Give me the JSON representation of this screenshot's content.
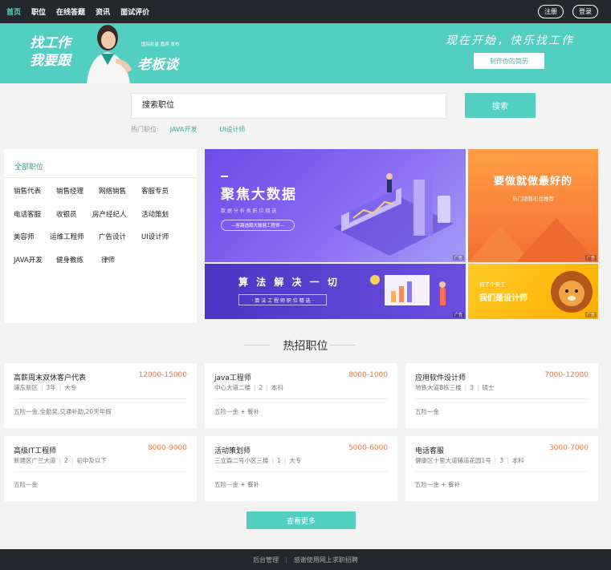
{
  "nav": {
    "items": [
      "首页",
      "职位",
      "在线答题",
      "资讯",
      "面试评价"
    ],
    "register": "注册",
    "login": "登录"
  },
  "banner": {
    "left_line1": "找工作",
    "left_line2": "我要跟",
    "small_text": "国际影星 嘉宾 发布",
    "boss": "老板谈",
    "slogan": "现在开始，快乐找工作",
    "cta": "制作你的简历"
  },
  "search": {
    "placeholder": "搜索职位",
    "button": "搜索",
    "hot_label": "热门职位:",
    "hot_links": [
      "JAVA开发",
      "UI设计师"
    ]
  },
  "categories": {
    "title": "全部职位",
    "items": [
      "销售代表",
      "销售经理",
      "网络销售",
      "客服专员",
      "电话客服",
      "收银员",
      "房产经纪人",
      "活动策划",
      "美容师",
      "运维工程师",
      "广告设计",
      "UI设计师",
      "JAVA开发",
      "健身教练",
      "律师"
    ]
  },
  "promos": {
    "bigdata_title": "聚焦大数据",
    "bigdata_sub": "数 据 分 析 类 职 位 精 选",
    "bigdata_btn": "—各路选聘大数据工程师—",
    "algo_title": "算 法 解 决 一 切",
    "algo_sub": "· 算 法 工 程 师 职 位 精 选 ·",
    "best_title": "要做就做最好的",
    "best_sub": "热门销售职位推荐",
    "designer_small": "招了个美工",
    "designer_title": "我们是设计师",
    "ad_tag": "广告"
  },
  "section_title": "热招职位",
  "jobs": [
    {
      "title": "高薪周末双休客户代表",
      "salary": "12000-15000",
      "meta": [
        "浦东新区",
        "3年",
        "大专"
      ],
      "benefit": "五险一金,全勤奖,交通补助,20天年假"
    },
    {
      "title": "java工程师",
      "salary": "8000-1000",
      "meta": [
        "中心大道二楼",
        "2",
        "本科"
      ],
      "benefit": "五险一金 + 餐补"
    },
    {
      "title": "应用软件设计师",
      "salary": "7000-12000",
      "meta": [
        "地铁大道B栋三楼",
        "3",
        "硕士"
      ],
      "benefit": "五险一金"
    },
    {
      "title": "高级IT工程师",
      "salary": "8000-9000",
      "meta": [
        "新建区广兰大道",
        "2",
        "初中及以下"
      ],
      "benefit": "五险一金"
    },
    {
      "title": "活动策划师",
      "salary": "5000-6000",
      "meta": [
        "三立森二号小区三楼",
        "1",
        "大专"
      ],
      "benefit": "五险一金 + 餐补"
    },
    {
      "title": "电话客服",
      "salary": "3000-7000",
      "meta": [
        "健康区十里大道辅道花园1号",
        "3",
        "本科"
      ],
      "benefit": "五险一金 + 餐补"
    }
  ],
  "more_button": "查看更多",
  "footer": {
    "admin": "后台管理",
    "thanks": "感谢使用网上求职招聘"
  },
  "colors": {
    "accent": "#52cfc1",
    "dark": "#24272c",
    "salary": "#ea7a3c"
  }
}
